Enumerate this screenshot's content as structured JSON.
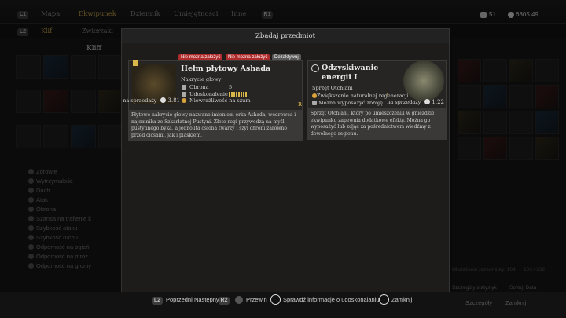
{
  "topbar": {
    "l1": "L1",
    "r1": "R1",
    "tabs": [
      "Mapa",
      "Ekwipunek",
      "Dziennik",
      "Umiejętności",
      "Inne"
    ],
    "currency_a": "51",
    "currency_b": "6805.49"
  },
  "subbar": {
    "l2": "L2",
    "tabs": [
      "Klif",
      "Zwierzaki"
    ]
  },
  "left": {
    "section_title": "Kliff",
    "stats": [
      "Zdrowie",
      "Wytrzymałość",
      "Duch",
      "Atak",
      "Obrona",
      "Szansa na trafienie k",
      "Szybkość ataku",
      "Szybkość ruchu",
      "Odporność na ogień",
      "Odporność na mróz",
      "Odporność na gromy"
    ]
  },
  "modal": {
    "title": "Zbadaj przedmiot",
    "item1": {
      "tags": [
        "Nie można założyć",
        "Nie można założyć",
        "Dezaktywuj"
      ],
      "name": "Hełm płytowy Ashada",
      "category": "Nakrycie głowy",
      "stat_label_1": "Obrona",
      "stat_val_1": "5",
      "stat_label_2": "Udoskonalenie",
      "note": "Niewrażliwość na szum",
      "price_label": "na sprzedaży",
      "price": "3.81",
      "price_hint": "R",
      "description": "Płytowe nakrycie głowy nazwane imieniem orka Ashada, wędrowca i najemnika ze Szkarłatnej Pustyni. Złote rogi przywodzą na myśl pustynnego byka, a jednolita osłona twarzy i szyi chroni zarówno przed ciosami, jak i piaskiem."
    },
    "item2": {
      "name_line1": "Odzyskiwanie",
      "name_line2": "energii I",
      "category": "Sprzęt Otchłani",
      "effect": "Zwiększenie naturalnej regeneracji",
      "effect_val": "1",
      "note": "Można wyposażyć zbroję",
      "price_label": "na sprzedaży",
      "price": "1.22",
      "description": "Sprzęt Otchłani, który po umieszczeniu w gnieździe ekwipunku zapewnia dodatkowe efekty. Można go wyposażyć lub zdjąć za pośrednictwem wiedźmy z dowolnego regionu."
    }
  },
  "right": {
    "weight": "Obciążenie przedmioty: 104",
    "slots": "103 / 232",
    "stats_hint": "Szczegóły statystyk",
    "sort_hint": "Sortuj: Data"
  },
  "bottom": {
    "l2": "L2",
    "r2": "R2",
    "prev": "Poprzedni",
    "next": "Następny",
    "scroll": "Przewiń",
    "check": "Sprawdź informacje o udoskonalaniu",
    "close": "Zamknij",
    "details": "Szczegóły",
    "close2": "Zamknij"
  }
}
